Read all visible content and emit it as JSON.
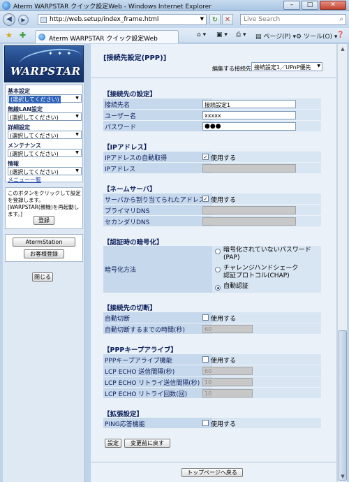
{
  "window": {
    "title": "Aterm WARPSTAR クイック設定Web - Windows Internet Explorer",
    "minimize": "–",
    "maximize": "□",
    "close": "✕"
  },
  "address": {
    "url": "http://web.setup/index_frame.html",
    "search_placeholder": "Live Search"
  },
  "tab": {
    "label": "Aterm WARPSTAR クイック設定Web"
  },
  "toolbar": {
    "page": "ページ(P)",
    "tools": "ツール(O)"
  },
  "sidebar": {
    "brand": "WARPSTAR",
    "menus": [
      {
        "label": "基本設定",
        "value": "(選択してください)"
      },
      {
        "label": "無線LAN設定",
        "value": "(選択してください)"
      },
      {
        "label": "詳細設定",
        "value": "(選択してください)"
      },
      {
        "label": "メンテナンス",
        "value": "(選択してください)"
      },
      {
        "label": "情報",
        "value": "(選択してください)"
      }
    ],
    "menu_list_link": "メニュー一覧",
    "note": "このボタンをクリックして設定を登録します。[WARPSTAR(親機)を再起動します。]",
    "register_button": "登録",
    "aterm_station_button": "AtermStation",
    "customer_register_button": "お客様登録",
    "close_button": "閉じる"
  },
  "main": {
    "page_title": "[接続先設定(PPP)]",
    "edit_conn_label": "編集する接続先",
    "edit_conn_value": "接続設定1／UPnP優先",
    "sections": {
      "dest": {
        "title": "【接続先の設定】",
        "name_label": "接続先名",
        "name_value": "接続設定1",
        "user_label": "ユーザー名",
        "user_value": "xxxxx",
        "pass_label": "パスワード",
        "pass_value": "●●●"
      },
      "ip": {
        "title": "【IPアドレス】",
        "auto_label": "IPアドレスの自動取得",
        "auto_check": "使用する",
        "addr_label": "IPアドレス"
      },
      "dns": {
        "title": "【ネームサーバ】",
        "auto_label": "サーバから割り当てられたアドレス",
        "auto_check": "使用する",
        "primary_label": "プライマリDNS",
        "secondary_label": "セカンダリDNS"
      },
      "auth": {
        "title": "【認証時の暗号化】",
        "method_label": "暗号化方法",
        "opt1": "暗号化されていないパスワード(PAP)",
        "opt2": "チャレンジハンドシェーク認証プロトコル(CHAP)",
        "opt3": "自動認証"
      },
      "disconnect": {
        "title": "【接続先の切断】",
        "auto_label": "自動切断",
        "auto_check": "使用する",
        "time_label": "自動切断するまでの時間(秒)",
        "time_value": "60"
      },
      "keepalive": {
        "title": "【PPPキープアライブ】",
        "func_label": "PPPキープアライブ機能",
        "func_check": "使用する",
        "interval_label": "LCP ECHO 送信間隔(秒)",
        "interval_value": "60",
        "retry_interval_label": "LCP ECHO リトライ送信間隔(秒)",
        "retry_interval_value": "10",
        "retry_count_label": "LCP ECHO リトライ回数(回)",
        "retry_count_value": "10"
      },
      "ext": {
        "title": "【拡張設定】",
        "ping_label": "PING応答機能",
        "ping_check": "使用する"
      }
    },
    "set_button": "設定",
    "revert_button": "変更前に戻す",
    "top_button": "トップページへ戻る"
  },
  "colors": {
    "row_label_bg": "#c6d8ec",
    "row_value_bg": "#d8e5f2",
    "heading": "#0b1f5c",
    "content_bg": "#eaf1f8"
  }
}
